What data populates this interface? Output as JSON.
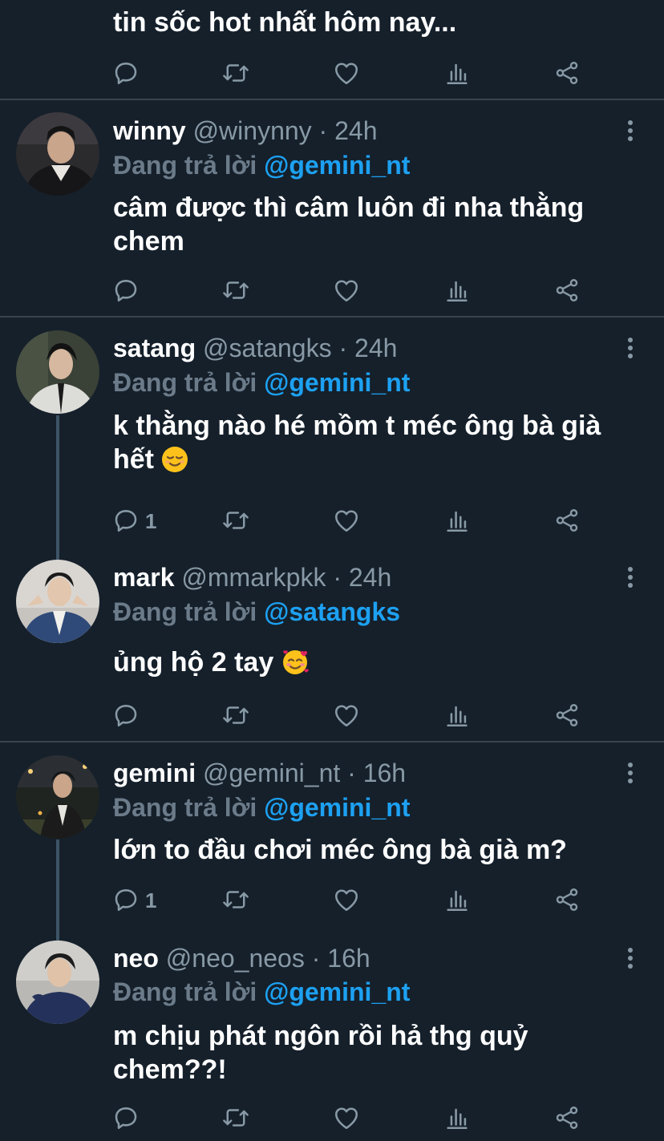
{
  "top_tweet": {
    "text_tail": "tin sốc hot nhất hôm nay..."
  },
  "reply_prefix": "Đang trả lời",
  "colors": {
    "background": "#15202b",
    "divider": "#38444d",
    "muted": "#8899a6",
    "link": "#1da1f2",
    "thread_line": "#3d5466"
  },
  "icons": {
    "reply": "speech-bubble",
    "retweet": "loop-arrows",
    "like": "heart-outline",
    "analytics": "bar-chart",
    "share": "share-nodes",
    "more": "vertical-ellipsis"
  },
  "tweets": [
    {
      "name": "winny",
      "handle": "@winynny",
      "time": "· 24h",
      "reply_to": "@gemini_nt",
      "text_line1": "câm được thì câm luôn đi nha thằng",
      "text_line2": "chem",
      "reply_count": ""
    },
    {
      "name": "satang",
      "handle": "@satangks",
      "time": "· 24h",
      "reply_to": "@gemini_nt",
      "text_line1": "k thằng nào hé mồm t méc ông bà già",
      "text_line2": "hết",
      "emoji": "😌",
      "reply_count": "1"
    },
    {
      "name": "mark",
      "handle": "@mmarkpkk",
      "time": "· 24h",
      "reply_to": "@satangks",
      "text_line1": "ủng hộ 2 tay",
      "emoji": "🥰",
      "reply_count": ""
    },
    {
      "name": "gemini",
      "handle": "@gemini_nt",
      "time": "· 16h",
      "reply_to": "@gemini_nt",
      "text_line1": "lớn to đầu chơi méc ông bà già m?",
      "reply_count": "1"
    },
    {
      "name": "neo",
      "handle": "@neo_neos",
      "time": "· 16h",
      "reply_to": "@gemini_nt",
      "text_line1": "m chịu phát ngôn rồi hả thg quỷ",
      "text_line2": "chem??!",
      "reply_count": ""
    }
  ]
}
